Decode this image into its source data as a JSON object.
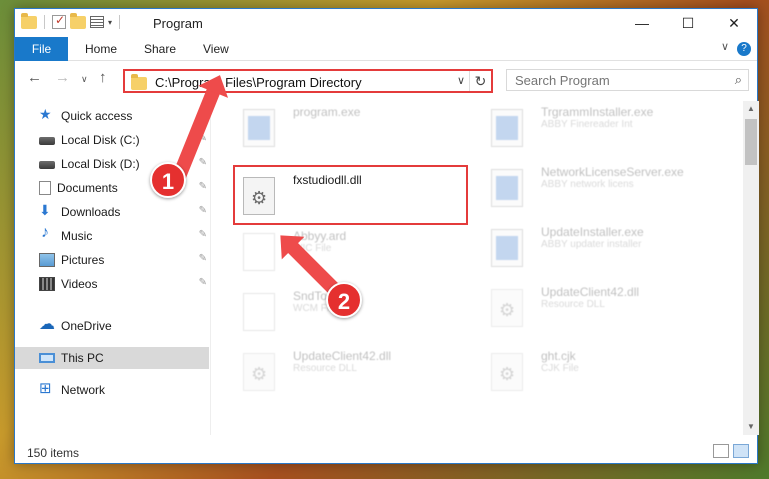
{
  "window": {
    "title": "Program",
    "controls": {
      "minimize": "—",
      "maximize": "☐",
      "close": "✕"
    }
  },
  "ribbon": {
    "tabs": [
      "File",
      "Home",
      "Share",
      "View"
    ],
    "help": "?",
    "expand": "∨"
  },
  "nav": {
    "back": "←",
    "forward": "→",
    "recent": "∨",
    "up": "↑",
    "address": "C:\\Program Files\\Program Directory",
    "address_dropdown": "∨",
    "refresh": "↻",
    "search_placeholder": "Search Program",
    "search_icon_glyph": "⌕"
  },
  "sidebar": {
    "items": [
      {
        "label": "Quick access",
        "icon": "star-icon",
        "pinned": false
      },
      {
        "label": "Local Disk (C:)",
        "icon": "disk-icon",
        "pinned": true
      },
      {
        "label": "Local Disk (D:)",
        "icon": "disk-icon",
        "pinned": true
      },
      {
        "label": "Documents",
        "icon": "document-icon",
        "pinned": true
      },
      {
        "label": "Downloads",
        "icon": "download-icon",
        "pinned": true
      },
      {
        "label": "Music",
        "icon": "music-icon",
        "pinned": true
      },
      {
        "label": "Pictures",
        "icon": "pictures-icon",
        "pinned": true
      },
      {
        "label": "Videos",
        "icon": "video-icon",
        "pinned": true
      },
      {
        "label": "OneDrive",
        "icon": "cloud-icon",
        "pinned": false
      },
      {
        "label": "This PC",
        "icon": "computer-icon",
        "pinned": false,
        "selected": true
      },
      {
        "label": "Network",
        "icon": "network-icon",
        "pinned": false
      }
    ],
    "pin_glyph": "📌"
  },
  "files": [
    {
      "name": "program.exe",
      "desc": "",
      "icon": "exe-icon",
      "faded": true
    },
    {
      "name": "TrgrammInstaller.exe",
      "desc": "ABBY Finereader Int",
      "icon": "exe-icon",
      "faded": true
    },
    {
      "name": "fxstudiodll.dll",
      "desc": "",
      "icon": "dll-icon",
      "faded": false
    },
    {
      "name": "NetworkLicenseServer.exe",
      "desc": "ABBY network licens",
      "icon": "exe-icon",
      "faded": true
    },
    {
      "name": "Abbyy.ard",
      "desc": "WIC File",
      "icon": "file-icon",
      "faded": true
    },
    {
      "name": "UpdateInstaller.exe",
      "desc": "ABBY updater installer",
      "icon": "exe-icon",
      "faded": true
    },
    {
      "name": "SndTo...cm",
      "desc": "WCM File",
      "icon": "file-icon",
      "faded": true
    },
    {
      "name": "UpdateClient42.dll",
      "desc": "Resource DLL",
      "icon": "dll-icon",
      "faded": true
    },
    {
      "name": "UpdateClient42.dll",
      "desc": "Resource DLL",
      "icon": "dll-icon",
      "faded": true
    },
    {
      "name": "ght.cjk",
      "desc": "CJK File",
      "icon": "dll-icon",
      "faded": true
    }
  ],
  "status": {
    "count": "150 items"
  },
  "annotations": {
    "step1": "1",
    "step2": "2",
    "accent": "#e43b3b"
  }
}
